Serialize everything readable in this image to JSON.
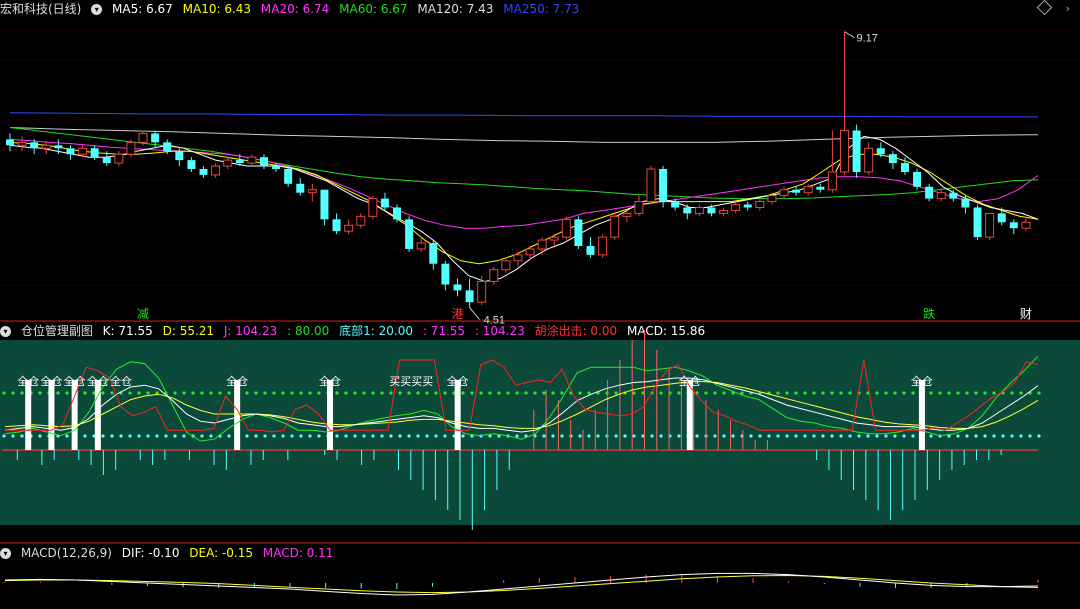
{
  "colors": {
    "bg": "#000000",
    "panel_bg": "#0b4a3b",
    "up": "#e8463c",
    "down": "#54ffff",
    "ma5": "#ffffff",
    "ma10": "#ffff00",
    "ma20": "#ff33ff",
    "ma60": "#22dd22",
    "ma120": "#cccccc",
    "ma250": "#3344ff",
    "grid": "#aa2222"
  },
  "header_main": {
    "title": "宏和科技(日线)",
    "ma5": "MA5: 6.67",
    "ma10": "MA10: 6.43",
    "ma20": "MA20: 6.74",
    "ma60": "MA60: 6.67",
    "ma120": "MA120: 7.43",
    "ma250": "MA250: 7.73"
  },
  "header_sub": {
    "title": "仓位管理副图",
    "k": "K: 71.55",
    "d": "D: 55.21",
    "j": "J: 104.23",
    "j2": ": 80.00",
    "bottom": "底部1: 20.00",
    "v1": ": 71.55",
    "v2": ": 104.23",
    "hutu": "胡涂出击: 0.00",
    "macd": "MACD: 15.86"
  },
  "header_macd": {
    "title": "MACD(12,26,9)",
    "dif": "DIF: -0.10",
    "dea": "DEA: -0.15",
    "macd": "MACD: 0.11"
  },
  "chart_data": [
    {
      "type": "candlestick",
      "name": "price",
      "annotations": {
        "high": "9.17",
        "low": "4.51"
      },
      "event_labels": [
        {
          "index": 11,
          "text": "减",
          "color": "#22dd22"
        },
        {
          "index": 37,
          "text": "港",
          "color": "#ff3333"
        },
        {
          "index": 76,
          "text": "跌",
          "color": "#22dd22"
        },
        {
          "index": 84,
          "text": "财",
          "color": "#ffffff"
        }
      ],
      "candles": [
        [
          7.35,
          7.25,
          7.45,
          7.15
        ],
        [
          7.25,
          7.3,
          7.4,
          7.15
        ],
        [
          7.3,
          7.2,
          7.35,
          7.1
        ],
        [
          7.2,
          7.25,
          7.3,
          7.1
        ],
        [
          7.25,
          7.2,
          7.35,
          7.1
        ],
        [
          7.2,
          7.1,
          7.25,
          7.0
        ],
        [
          7.1,
          7.2,
          7.25,
          7.05
        ],
        [
          7.2,
          7.05,
          7.25,
          7.0
        ],
        [
          7.05,
          6.95,
          7.15,
          6.9
        ],
        [
          6.95,
          7.1,
          7.15,
          6.9
        ],
        [
          7.1,
          7.3,
          7.35,
          7.05
        ],
        [
          7.3,
          7.45,
          7.5,
          7.25
        ],
        [
          7.45,
          7.3,
          7.5,
          7.2
        ],
        [
          7.3,
          7.15,
          7.35,
          7.1
        ],
        [
          7.15,
          7.0,
          7.2,
          6.9
        ],
        [
          7.0,
          6.85,
          7.05,
          6.8
        ],
        [
          6.85,
          6.75,
          6.9,
          6.7
        ],
        [
          6.75,
          6.9,
          6.95,
          6.7
        ],
        [
          6.9,
          7.0,
          7.05,
          6.85
        ],
        [
          7.0,
          6.95,
          7.1,
          6.9
        ],
        [
          6.95,
          7.05,
          7.1,
          6.9
        ],
        [
          7.05,
          6.9,
          7.1,
          6.85
        ],
        [
          6.9,
          6.85,
          6.95,
          6.8
        ],
        [
          6.85,
          6.6,
          6.9,
          6.55
        ],
        [
          6.6,
          6.45,
          6.7,
          6.4
        ],
        [
          6.45,
          6.5,
          6.6,
          6.3
        ],
        [
          6.5,
          6.0,
          6.5,
          5.9
        ],
        [
          6.0,
          5.8,
          6.1,
          5.75
        ],
        [
          5.8,
          5.9,
          6.0,
          5.75
        ],
        [
          5.9,
          6.05,
          6.1,
          5.85
        ],
        [
          6.05,
          6.35,
          6.4,
          6.0
        ],
        [
          6.35,
          6.2,
          6.45,
          6.15
        ],
        [
          6.2,
          6.0,
          6.25,
          5.95
        ],
        [
          6.0,
          5.5,
          6.05,
          5.45
        ],
        [
          5.5,
          5.6,
          5.7,
          5.45
        ],
        [
          5.6,
          5.25,
          5.65,
          5.15
        ],
        [
          5.25,
          4.9,
          5.3,
          4.8
        ],
        [
          4.9,
          4.8,
          5.0,
          4.7
        ],
        [
          4.8,
          4.6,
          5.0,
          4.51
        ],
        [
          4.6,
          4.95,
          5.05,
          4.55
        ],
        [
          4.95,
          5.15,
          5.2,
          4.9
        ],
        [
          5.15,
          5.3,
          5.35,
          5.1
        ],
        [
          5.3,
          5.4,
          5.45,
          5.2
        ],
        [
          5.4,
          5.5,
          5.55,
          5.3
        ],
        [
          5.5,
          5.65,
          5.7,
          5.4
        ],
        [
          5.65,
          5.7,
          5.75,
          5.55
        ],
        [
          5.7,
          6.0,
          6.05,
          5.65
        ],
        [
          6.0,
          5.55,
          6.05,
          5.5
        ],
        [
          5.55,
          5.4,
          5.7,
          5.35
        ],
        [
          5.4,
          5.7,
          5.75,
          5.35
        ],
        [
          5.7,
          6.05,
          6.1,
          5.65
        ],
        [
          6.05,
          6.1,
          6.15,
          5.95
        ],
        [
          6.1,
          6.3,
          6.4,
          6.05
        ],
        [
          6.3,
          6.85,
          6.9,
          6.25
        ],
        [
          6.85,
          6.3,
          6.9,
          6.2
        ],
        [
          6.3,
          6.2,
          6.35,
          6.15
        ],
        [
          6.2,
          6.1,
          6.25,
          6.0
        ],
        [
          6.1,
          6.2,
          6.25,
          6.05
        ],
        [
          6.2,
          6.1,
          6.25,
          6.05
        ],
        [
          6.1,
          6.15,
          6.2,
          6.05
        ],
        [
          6.15,
          6.25,
          6.3,
          6.1
        ],
        [
          6.25,
          6.2,
          6.3,
          6.15
        ],
        [
          6.2,
          6.3,
          6.35,
          6.15
        ],
        [
          6.3,
          6.4,
          6.45,
          6.25
        ],
        [
          6.4,
          6.5,
          6.55,
          6.35
        ],
        [
          6.5,
          6.45,
          6.55,
          6.4
        ],
        [
          6.45,
          6.55,
          6.6,
          6.4
        ],
        [
          6.55,
          6.5,
          6.6,
          6.45
        ],
        [
          6.5,
          6.8,
          7.5,
          6.45
        ],
        [
          6.8,
          7.5,
          9.17,
          6.75
        ],
        [
          7.5,
          6.8,
          7.6,
          6.7
        ],
        [
          6.8,
          7.2,
          7.3,
          6.75
        ],
        [
          7.2,
          7.1,
          7.3,
          7.05
        ],
        [
          7.1,
          6.95,
          7.15,
          6.85
        ],
        [
          6.95,
          6.8,
          7.05,
          6.75
        ],
        [
          6.8,
          6.55,
          6.85,
          6.5
        ],
        [
          6.55,
          6.35,
          6.6,
          6.3
        ],
        [
          6.35,
          6.45,
          6.5,
          6.3
        ],
        [
          6.45,
          6.35,
          6.5,
          6.3
        ],
        [
          6.35,
          6.2,
          6.4,
          6.1
        ],
        [
          6.2,
          5.7,
          6.25,
          5.65
        ],
        [
          5.7,
          6.1,
          6.1,
          5.65
        ],
        [
          6.1,
          5.95,
          6.2,
          5.9
        ],
        [
          5.95,
          5.85,
          6.0,
          5.75
        ],
        [
          5.85,
          5.95,
          6.05,
          5.8
        ]
      ],
      "ma_lines": {
        "ma5": [
          7.25,
          7.22,
          7.2,
          7.15,
          7.1,
          7.05,
          7.05,
          7.08,
          7.15,
          7.2,
          7.25,
          7.2,
          7.1,
          7.0,
          6.95,
          6.9,
          6.9,
          6.9,
          6.85,
          6.75,
          6.65,
          6.5,
          6.35,
          6.25,
          6.1,
          5.95,
          5.8,
          5.6,
          5.3,
          5.05,
          4.95,
          5.0,
          5.15,
          5.35,
          5.5,
          5.6,
          5.75,
          5.9,
          6.0,
          6.15,
          6.3,
          6.35,
          6.3,
          6.2,
          6.2,
          6.25,
          6.3,
          6.35,
          6.4,
          6.45,
          6.5,
          6.6,
          6.7,
          7.2,
          7.4,
          7.35,
          7.2,
          7.0,
          6.8,
          6.55,
          6.4,
          6.3,
          6.2,
          6.15,
          6.1,
          6.0
        ],
        "ma10": [
          7.3,
          7.28,
          7.25,
          7.2,
          7.15,
          7.12,
          7.1,
          7.1,
          7.12,
          7.15,
          7.15,
          7.1,
          7.05,
          7.0,
          6.95,
          6.9,
          6.85,
          6.75,
          6.6,
          6.45,
          6.3,
          6.1,
          5.9,
          5.65,
          5.45,
          5.3,
          5.25,
          5.3,
          5.4,
          5.55,
          5.7,
          5.85,
          5.95,
          6.05,
          6.15,
          6.25,
          6.3,
          6.3,
          6.3,
          6.3,
          6.3,
          6.35,
          6.4,
          6.5,
          6.6,
          6.8,
          7.0,
          7.1,
          7.1,
          7.05,
          6.95,
          6.8,
          6.6,
          6.4,
          6.25,
          6.15,
          6.05,
          6.0
        ],
        "ma20": [
          7.35,
          7.33,
          7.3,
          7.28,
          7.25,
          7.22,
          7.2,
          7.18,
          7.16,
          7.15,
          7.12,
          7.1,
          7.05,
          6.98,
          6.9,
          6.8,
          6.68,
          6.55,
          6.4,
          6.25,
          6.1,
          5.98,
          5.9,
          5.85,
          5.85,
          5.88,
          5.9,
          5.95,
          6.0,
          6.1,
          6.15,
          6.2,
          6.25,
          6.3,
          6.35,
          6.4,
          6.45,
          6.5,
          6.55,
          6.6,
          6.65,
          6.7,
          6.72,
          6.72,
          6.7,
          6.65,
          6.55,
          6.45,
          6.35,
          6.3,
          6.35,
          6.5,
          6.74
        ],
        "ma60": [
          7.55,
          7.5,
          7.45,
          7.4,
          7.35,
          7.3,
          7.25,
          7.2,
          7.15,
          7.08,
          7.0,
          6.92,
          6.85,
          6.78,
          6.72,
          6.68,
          6.65,
          6.62,
          6.6,
          6.58,
          6.55,
          6.52,
          6.5,
          6.48,
          6.45,
          6.42,
          6.4,
          6.38,
          6.36,
          6.35,
          6.35,
          6.35,
          6.36,
          6.38,
          6.4,
          6.42,
          6.45,
          6.5,
          6.55,
          6.6,
          6.65,
          6.67
        ],
        "ma120": [
          7.55,
          7.52,
          7.5,
          7.48,
          7.45,
          7.42,
          7.4,
          7.38,
          7.35,
          7.33,
          7.32,
          7.3,
          7.3,
          7.3,
          7.32,
          7.35,
          7.38,
          7.4,
          7.42,
          7.43
        ],
        "ma250": [
          7.8,
          7.79,
          7.78,
          7.78,
          7.77,
          7.77,
          7.76,
          7.76,
          7.75,
          7.75,
          7.75,
          7.74,
          7.74,
          7.74,
          7.73,
          7.73,
          7.73
        ]
      }
    },
    {
      "type": "line",
      "name": "position-management",
      "levels": [
        80,
        20
      ],
      "labels": [
        {
          "index": 2,
          "text": "全仓"
        },
        {
          "index": 4,
          "text": "全仓"
        },
        {
          "index": 6,
          "text": "全仓"
        },
        {
          "index": 8,
          "text": "全仓"
        },
        {
          "index": 10,
          "text": "全仓"
        },
        {
          "index": 20,
          "text": "全仓"
        },
        {
          "index": 28,
          "text": "全仓"
        },
        {
          "index": 35,
          "text": "买买买买"
        },
        {
          "index": 39,
          "text": "全仓"
        },
        {
          "index": 59,
          "text": "全仓"
        },
        {
          "index": 79,
          "text": "全仓"
        }
      ],
      "white_bars": [
        2,
        4,
        6,
        8,
        20,
        28,
        39,
        59,
        79
      ],
      "red_line": [
        22,
        22,
        22,
        22,
        22,
        28,
        60,
        92,
        88,
        80,
        48,
        38,
        42,
        48,
        22,
        22,
        22,
        22,
        24,
        60,
        45,
        22,
        22,
        20,
        22,
        45,
        50,
        40,
        22,
        22,
        22,
        22,
        22,
        22,
        100,
        100,
        100,
        100,
        22,
        22,
        22,
        95,
        100,
        92,
        72,
        75,
        78,
        75,
        90,
        60,
        45,
        42,
        40,
        38,
        40,
        48,
        70,
        88,
        95,
        70,
        55,
        42,
        38,
        32,
        28,
        22,
        22,
        22,
        22,
        22,
        22,
        22,
        22,
        22,
        100,
        22,
        22,
        22,
        22,
        22,
        25,
        22,
        30,
        38,
        48,
        58,
        65,
        75,
        98,
        95
      ],
      "k_line": [
        22,
        24,
        26,
        24,
        22,
        25,
        35,
        50,
        62,
        70,
        72,
        68,
        55,
        40,
        32,
        30,
        34,
        38,
        40,
        38,
        35,
        30,
        28,
        26,
        26,
        28,
        30,
        32,
        34,
        36,
        38,
        36,
        30,
        26,
        24,
        24,
        22,
        20,
        22,
        30,
        42,
        55,
        62,
        68,
        72,
        75,
        76,
        78,
        80,
        80,
        78,
        74,
        70,
        66,
        62,
        56,
        50,
        46,
        42,
        38,
        34,
        30,
        28,
        26,
        26,
        26,
        24,
        22,
        22,
        24,
        30,
        40,
        50,
        60,
        71.55
      ],
      "d_line": [
        26,
        27,
        28,
        27,
        26,
        27,
        32,
        40,
        48,
        56,
        60,
        62,
        58,
        50,
        44,
        40,
        40,
        40,
        40,
        39,
        37,
        34,
        31,
        29,
        28,
        28,
        29,
        30,
        31,
        33,
        34,
        34,
        32,
        30,
        28,
        27,
        25,
        24,
        24,
        27,
        33,
        40,
        48,
        56,
        62,
        67,
        70,
        72,
        74,
        76,
        76,
        75,
        72,
        69,
        65,
        61,
        57,
        53,
        49,
        45,
        41,
        37,
        34,
        31,
        29,
        28,
        27,
        25,
        24,
        24,
        26,
        31,
        38,
        46,
        55.21
      ],
      "j_line": [
        18,
        20,
        24,
        20,
        16,
        22,
        42,
        70,
        90,
        98,
        96,
        80,
        50,
        20,
        10,
        12,
        24,
        34,
        40,
        36,
        30,
        22,
        22,
        20,
        22,
        28,
        32,
        35,
        38,
        40,
        44,
        40,
        26,
        18,
        16,
        18,
        16,
        12,
        18,
        36,
        60,
        86,
        92,
        92,
        92,
        92,
        88,
        90,
        92,
        88,
        82,
        72,
        66,
        60,
        56,
        46,
        36,
        32,
        30,
        26,
        24,
        20,
        18,
        18,
        20,
        24,
        20,
        16,
        18,
        24,
        38,
        58,
        74,
        88,
        104.23
      ],
      "hist": [
        0,
        -2,
        0,
        -3,
        -2,
        0,
        -2,
        -3,
        -5,
        -4,
        0,
        -2,
        -3,
        -2,
        0,
        -2,
        0,
        -3,
        -4,
        0,
        -3,
        -2,
        0,
        -2,
        0,
        0,
        -1,
        -2,
        0,
        -3,
        -2,
        0,
        -4,
        -6,
        -8,
        -10,
        -12,
        -14,
        -16,
        -12,
        -8,
        -4,
        0,
        8,
        12,
        10,
        6,
        4,
        8,
        14,
        18,
        22,
        24,
        20,
        16,
        14,
        12,
        10,
        8,
        6,
        4,
        2,
        2,
        0,
        0,
        0,
        -2,
        -4,
        -6,
        -8,
        -10,
        -12,
        -14,
        -12,
        -10,
        -8,
        -6,
        -4,
        -3,
        -2,
        -2,
        -1,
        0,
        0,
        0
      ]
    },
    {
      "type": "line",
      "name": "macd",
      "dif": [
        0.1,
        0.12,
        0.1,
        0.05,
        0,
        -0.05,
        -0.1,
        -0.15,
        -0.2,
        -0.28,
        -0.35,
        -0.4,
        -0.38,
        -0.3,
        -0.2,
        -0.1,
        0,
        0.1,
        0.2,
        0.28,
        0.32,
        0.32,
        0.28,
        0.2,
        0.1,
        0,
        -0.08,
        -0.12,
        -0.12,
        -0.1
      ],
      "dea": [
        0.08,
        0.1,
        0.1,
        0.08,
        0.05,
        0.02,
        -0.02,
        -0.08,
        -0.14,
        -0.2,
        -0.26,
        -0.3,
        -0.32,
        -0.3,
        -0.25,
        -0.18,
        -0.1,
        -0.02,
        0.06,
        0.14,
        0.2,
        0.24,
        0.25,
        0.22,
        0.16,
        0.08,
        0,
        -0.06,
        -0.12,
        -0.15
      ],
      "macd": [
        0.04,
        0.04,
        0,
        -0.06,
        -0.1,
        -0.14,
        -0.16,
        -0.14,
        -0.12,
        -0.16,
        -0.18,
        -0.2,
        -0.12,
        0,
        0.1,
        0.16,
        0.2,
        0.24,
        0.28,
        0.28,
        0.24,
        0.16,
        0.06,
        -0.04,
        -0.12,
        -0.16,
        -0.16,
        -0.12,
        0,
        0.11
      ]
    }
  ]
}
